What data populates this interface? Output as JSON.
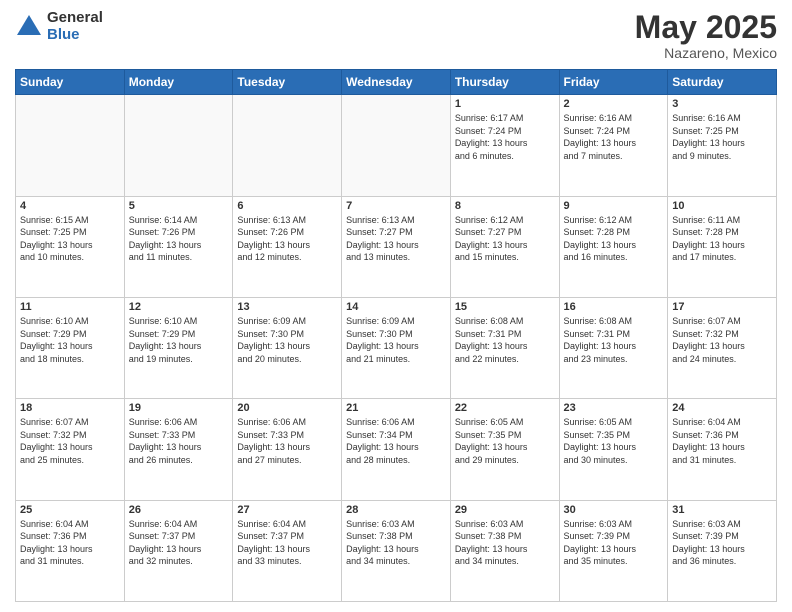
{
  "header": {
    "logo_general": "General",
    "logo_blue": "Blue",
    "main_title": "May 2025",
    "subtitle": "Nazareno, Mexico"
  },
  "calendar": {
    "days_of_week": [
      "Sunday",
      "Monday",
      "Tuesday",
      "Wednesday",
      "Thursday",
      "Friday",
      "Saturday"
    ],
    "weeks": [
      [
        {
          "day": "",
          "info": "",
          "empty": true
        },
        {
          "day": "",
          "info": "",
          "empty": true
        },
        {
          "day": "",
          "info": "",
          "empty": true
        },
        {
          "day": "",
          "info": "",
          "empty": true
        },
        {
          "day": "1",
          "info": "Sunrise: 6:17 AM\nSunset: 7:24 PM\nDaylight: 13 hours\nand 6 minutes.",
          "empty": false
        },
        {
          "day": "2",
          "info": "Sunrise: 6:16 AM\nSunset: 7:24 PM\nDaylight: 13 hours\nand 7 minutes.",
          "empty": false
        },
        {
          "day": "3",
          "info": "Sunrise: 6:16 AM\nSunset: 7:25 PM\nDaylight: 13 hours\nand 9 minutes.",
          "empty": false
        }
      ],
      [
        {
          "day": "4",
          "info": "Sunrise: 6:15 AM\nSunset: 7:25 PM\nDaylight: 13 hours\nand 10 minutes.",
          "empty": false
        },
        {
          "day": "5",
          "info": "Sunrise: 6:14 AM\nSunset: 7:26 PM\nDaylight: 13 hours\nand 11 minutes.",
          "empty": false
        },
        {
          "day": "6",
          "info": "Sunrise: 6:13 AM\nSunset: 7:26 PM\nDaylight: 13 hours\nand 12 minutes.",
          "empty": false
        },
        {
          "day": "7",
          "info": "Sunrise: 6:13 AM\nSunset: 7:27 PM\nDaylight: 13 hours\nand 13 minutes.",
          "empty": false
        },
        {
          "day": "8",
          "info": "Sunrise: 6:12 AM\nSunset: 7:27 PM\nDaylight: 13 hours\nand 15 minutes.",
          "empty": false
        },
        {
          "day": "9",
          "info": "Sunrise: 6:12 AM\nSunset: 7:28 PM\nDaylight: 13 hours\nand 16 minutes.",
          "empty": false
        },
        {
          "day": "10",
          "info": "Sunrise: 6:11 AM\nSunset: 7:28 PM\nDaylight: 13 hours\nand 17 minutes.",
          "empty": false
        }
      ],
      [
        {
          "day": "11",
          "info": "Sunrise: 6:10 AM\nSunset: 7:29 PM\nDaylight: 13 hours\nand 18 minutes.",
          "empty": false
        },
        {
          "day": "12",
          "info": "Sunrise: 6:10 AM\nSunset: 7:29 PM\nDaylight: 13 hours\nand 19 minutes.",
          "empty": false
        },
        {
          "day": "13",
          "info": "Sunrise: 6:09 AM\nSunset: 7:30 PM\nDaylight: 13 hours\nand 20 minutes.",
          "empty": false
        },
        {
          "day": "14",
          "info": "Sunrise: 6:09 AM\nSunset: 7:30 PM\nDaylight: 13 hours\nand 21 minutes.",
          "empty": false
        },
        {
          "day": "15",
          "info": "Sunrise: 6:08 AM\nSunset: 7:31 PM\nDaylight: 13 hours\nand 22 minutes.",
          "empty": false
        },
        {
          "day": "16",
          "info": "Sunrise: 6:08 AM\nSunset: 7:31 PM\nDaylight: 13 hours\nand 23 minutes.",
          "empty": false
        },
        {
          "day": "17",
          "info": "Sunrise: 6:07 AM\nSunset: 7:32 PM\nDaylight: 13 hours\nand 24 minutes.",
          "empty": false
        }
      ],
      [
        {
          "day": "18",
          "info": "Sunrise: 6:07 AM\nSunset: 7:32 PM\nDaylight: 13 hours\nand 25 minutes.",
          "empty": false
        },
        {
          "day": "19",
          "info": "Sunrise: 6:06 AM\nSunset: 7:33 PM\nDaylight: 13 hours\nand 26 minutes.",
          "empty": false
        },
        {
          "day": "20",
          "info": "Sunrise: 6:06 AM\nSunset: 7:33 PM\nDaylight: 13 hours\nand 27 minutes.",
          "empty": false
        },
        {
          "day": "21",
          "info": "Sunrise: 6:06 AM\nSunset: 7:34 PM\nDaylight: 13 hours\nand 28 minutes.",
          "empty": false
        },
        {
          "day": "22",
          "info": "Sunrise: 6:05 AM\nSunset: 7:35 PM\nDaylight: 13 hours\nand 29 minutes.",
          "empty": false
        },
        {
          "day": "23",
          "info": "Sunrise: 6:05 AM\nSunset: 7:35 PM\nDaylight: 13 hours\nand 30 minutes.",
          "empty": false
        },
        {
          "day": "24",
          "info": "Sunrise: 6:04 AM\nSunset: 7:36 PM\nDaylight: 13 hours\nand 31 minutes.",
          "empty": false
        }
      ],
      [
        {
          "day": "25",
          "info": "Sunrise: 6:04 AM\nSunset: 7:36 PM\nDaylight: 13 hours\nand 31 minutes.",
          "empty": false
        },
        {
          "day": "26",
          "info": "Sunrise: 6:04 AM\nSunset: 7:37 PM\nDaylight: 13 hours\nand 32 minutes.",
          "empty": false
        },
        {
          "day": "27",
          "info": "Sunrise: 6:04 AM\nSunset: 7:37 PM\nDaylight: 13 hours\nand 33 minutes.",
          "empty": false
        },
        {
          "day": "28",
          "info": "Sunrise: 6:03 AM\nSunset: 7:38 PM\nDaylight: 13 hours\nand 34 minutes.",
          "empty": false
        },
        {
          "day": "29",
          "info": "Sunrise: 6:03 AM\nSunset: 7:38 PM\nDaylight: 13 hours\nand 34 minutes.",
          "empty": false
        },
        {
          "day": "30",
          "info": "Sunrise: 6:03 AM\nSunset: 7:39 PM\nDaylight: 13 hours\nand 35 minutes.",
          "empty": false
        },
        {
          "day": "31",
          "info": "Sunrise: 6:03 AM\nSunset: 7:39 PM\nDaylight: 13 hours\nand 36 minutes.",
          "empty": false
        }
      ]
    ]
  }
}
